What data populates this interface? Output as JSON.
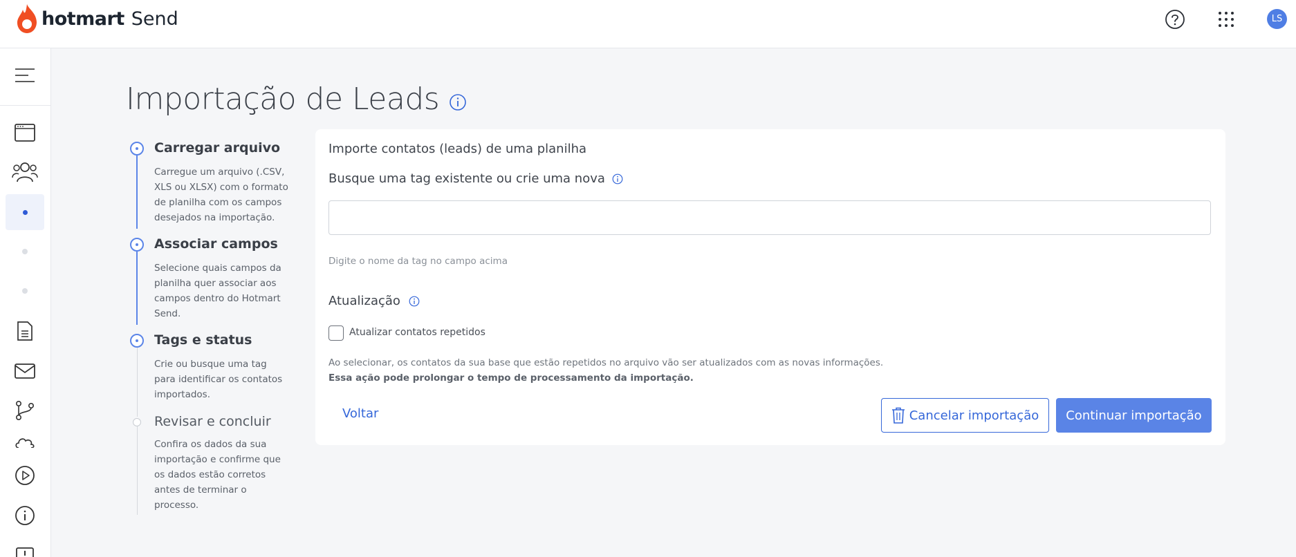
{
  "header": {
    "brand": "hotmart",
    "product": "Send",
    "avatar_initials": "LS",
    "icons": [
      "help-icon",
      "apps-grid-icon"
    ]
  },
  "sidebar": {
    "items": [
      {
        "icon": "menu-collapse-icon"
      },
      {
        "icon": "browser-window-icon"
      },
      {
        "icon": "contacts-group-icon"
      },
      {
        "icon": "dot-active",
        "active": true
      },
      {
        "icon": "dot"
      },
      {
        "icon": "dot"
      },
      {
        "icon": "document-icon"
      },
      {
        "icon": "envelope-icon"
      },
      {
        "icon": "automation-branch-icon"
      },
      {
        "icon": "cloud-icon"
      },
      {
        "icon": "play-circle-icon"
      },
      {
        "icon": "info-circle-icon"
      },
      {
        "icon": "list-icon"
      }
    ]
  },
  "page": {
    "title": "Importação de Leads"
  },
  "steps": [
    {
      "title": "Carregar arquivo",
      "desc": "Carregue um arquivo (.CSV, XLS ou XLSX) com o formato de planilha com os campos desejados na importação.",
      "state": "done"
    },
    {
      "title": "Associar campos",
      "desc": "Selecione quais campos da planilha quer associar aos campos dentro do Hotmart Send.",
      "state": "done"
    },
    {
      "title": "Tags e status",
      "desc": "Crie ou busque uma tag para identificar os contatos importados.",
      "state": "current"
    },
    {
      "title": "Revisar e concluir",
      "desc": "Confira os dados da sua importação e confirme que os dados estão corretos antes de terminar o processo.",
      "state": "pending"
    }
  ],
  "form": {
    "subtitle": "Importe contatos (leads) de uma planilha",
    "tag_label": "Busque uma tag existente ou crie uma nova",
    "tag_value": "",
    "tag_hint": "Digite o nome da tag no campo acima",
    "update_label": "Atualização",
    "update_checkbox_label": "Atualizar contatos repetidos",
    "update_checked": false,
    "note": "Ao selecionar, os contatos da sua base que estão repetidos no arquivo vão ser atualizados com as novas informações.",
    "note_strong": "Essa ação pode prolongar o tempo de processamento da importação."
  },
  "actions": {
    "back": "Voltar",
    "cancel": "Cancelar importação",
    "continue": "Continuar importação"
  },
  "colors": {
    "accent": "#5a84e6",
    "link": "#3567d9",
    "brand_flame": "#f04e23"
  }
}
